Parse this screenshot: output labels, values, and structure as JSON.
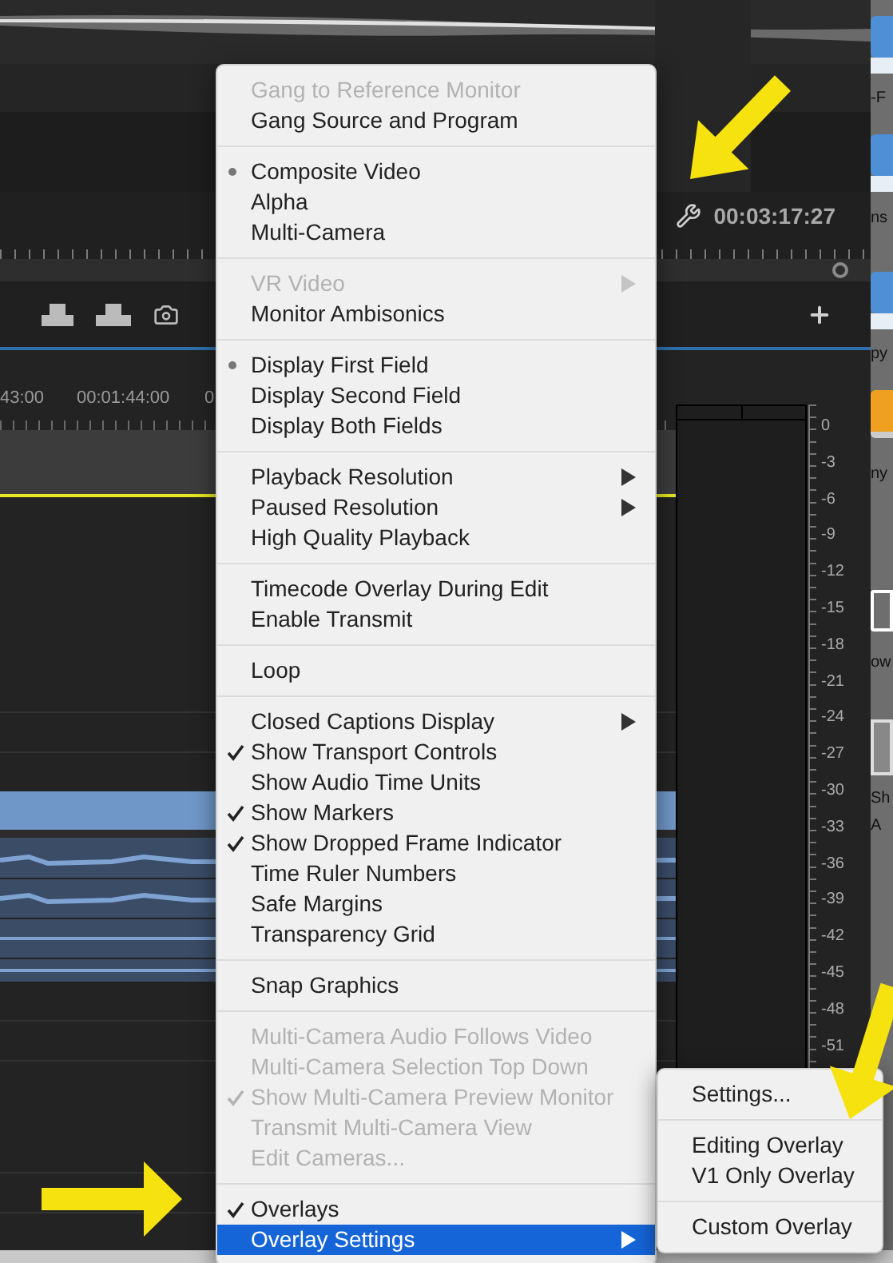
{
  "program_monitor": {
    "timecode": "00:03:17:27"
  },
  "timeline": {
    "time_labels": [
      "43:00",
      "00:01:44:00",
      "0"
    ]
  },
  "audio_meter": {
    "scale": [
      "0",
      "-3",
      "-6",
      "-9",
      "-12",
      "-15",
      "-18",
      "-21",
      "-24",
      "-27",
      "-30",
      "-33",
      "-36",
      "-39",
      "-42",
      "-45",
      "-48",
      "-51"
    ]
  },
  "desktop": {
    "labels": [
      "-F",
      "ns",
      "py",
      "ny",
      "ow",
      "Sh",
      "A"
    ]
  },
  "context_menu": {
    "sections": [
      {
        "items": [
          {
            "label": "Gang to Reference Monitor",
            "disabled": true,
            "checked": false,
            "submenu": false,
            "selected": false
          },
          {
            "label": "Gang Source and Program",
            "disabled": false,
            "checked": false,
            "submenu": false,
            "selected": false
          }
        ]
      },
      {
        "kind": "radio",
        "items": [
          {
            "label": "Composite Video",
            "disabled": false,
            "checked": true,
            "submenu": false,
            "selected": false
          },
          {
            "label": "Alpha",
            "disabled": false,
            "checked": false,
            "submenu": false,
            "selected": false
          },
          {
            "label": "Multi-Camera",
            "disabled": false,
            "checked": false,
            "submenu": false,
            "selected": false
          }
        ]
      },
      {
        "items": [
          {
            "label": "VR Video",
            "disabled": true,
            "checked": false,
            "submenu": true,
            "selected": false
          },
          {
            "label": "Monitor Ambisonics",
            "disabled": false,
            "checked": false,
            "submenu": false,
            "selected": false
          }
        ]
      },
      {
        "kind": "radio",
        "items": [
          {
            "label": "Display First Field",
            "disabled": false,
            "checked": true,
            "submenu": false,
            "selected": false
          },
          {
            "label": "Display Second Field",
            "disabled": false,
            "checked": false,
            "submenu": false,
            "selected": false
          },
          {
            "label": "Display Both Fields",
            "disabled": false,
            "checked": false,
            "submenu": false,
            "selected": false
          }
        ]
      },
      {
        "items": [
          {
            "label": "Playback Resolution",
            "disabled": false,
            "checked": false,
            "submenu": true,
            "selected": false
          },
          {
            "label": "Paused Resolution",
            "disabled": false,
            "checked": false,
            "submenu": true,
            "selected": false
          },
          {
            "label": "High Quality Playback",
            "disabled": false,
            "checked": false,
            "submenu": false,
            "selected": false
          }
        ]
      },
      {
        "items": [
          {
            "label": "Timecode Overlay During Edit",
            "disabled": false,
            "checked": false,
            "submenu": false,
            "selected": false
          },
          {
            "label": "Enable Transmit",
            "disabled": false,
            "checked": false,
            "submenu": false,
            "selected": false
          }
        ]
      },
      {
        "items": [
          {
            "label": "Loop",
            "disabled": false,
            "checked": false,
            "submenu": false,
            "selected": false
          }
        ]
      },
      {
        "kind": "check",
        "items": [
          {
            "label": "Closed Captions Display",
            "disabled": false,
            "checked": false,
            "submenu": true,
            "selected": false
          },
          {
            "label": "Show Transport Controls",
            "disabled": false,
            "checked": true,
            "submenu": false,
            "selected": false
          },
          {
            "label": "Show Audio Time Units",
            "disabled": false,
            "checked": false,
            "submenu": false,
            "selected": false
          },
          {
            "label": "Show Markers",
            "disabled": false,
            "checked": true,
            "submenu": false,
            "selected": false
          },
          {
            "label": "Show Dropped Frame Indicator",
            "disabled": false,
            "checked": true,
            "submenu": false,
            "selected": false
          },
          {
            "label": "Time Ruler Numbers",
            "disabled": false,
            "checked": false,
            "submenu": false,
            "selected": false
          },
          {
            "label": "Safe Margins",
            "disabled": false,
            "checked": false,
            "submenu": false,
            "selected": false
          },
          {
            "label": "Transparency Grid",
            "disabled": false,
            "checked": false,
            "submenu": false,
            "selected": false
          }
        ]
      },
      {
        "items": [
          {
            "label": "Snap Graphics",
            "disabled": false,
            "checked": false,
            "submenu": false,
            "selected": false
          }
        ]
      },
      {
        "kind": "check",
        "items": [
          {
            "label": "Multi-Camera Audio Follows Video",
            "disabled": true,
            "checked": false,
            "submenu": false,
            "selected": false
          },
          {
            "label": "Multi-Camera Selection Top Down",
            "disabled": true,
            "checked": false,
            "submenu": false,
            "selected": false
          },
          {
            "label": "Show Multi-Camera Preview Monitor",
            "disabled": true,
            "checked": true,
            "submenu": false,
            "selected": false
          },
          {
            "label": "Transmit Multi-Camera View",
            "disabled": true,
            "checked": false,
            "submenu": false,
            "selected": false
          },
          {
            "label": "Edit Cameras...",
            "disabled": true,
            "checked": false,
            "submenu": false,
            "selected": false
          }
        ]
      },
      {
        "kind": "check",
        "items": [
          {
            "label": "Overlays",
            "disabled": false,
            "checked": true,
            "submenu": false,
            "selected": false
          },
          {
            "label": "Overlay Settings",
            "disabled": false,
            "checked": false,
            "submenu": true,
            "selected": true
          }
        ]
      }
    ]
  },
  "submenu": {
    "sections": [
      {
        "items": [
          {
            "label": "Settings..."
          }
        ]
      },
      {
        "items": [
          {
            "label": "Editing Overlay"
          },
          {
            "label": "V1 Only Overlay"
          }
        ]
      },
      {
        "items": [
          {
            "label": "Custom Overlay"
          }
        ]
      }
    ]
  }
}
